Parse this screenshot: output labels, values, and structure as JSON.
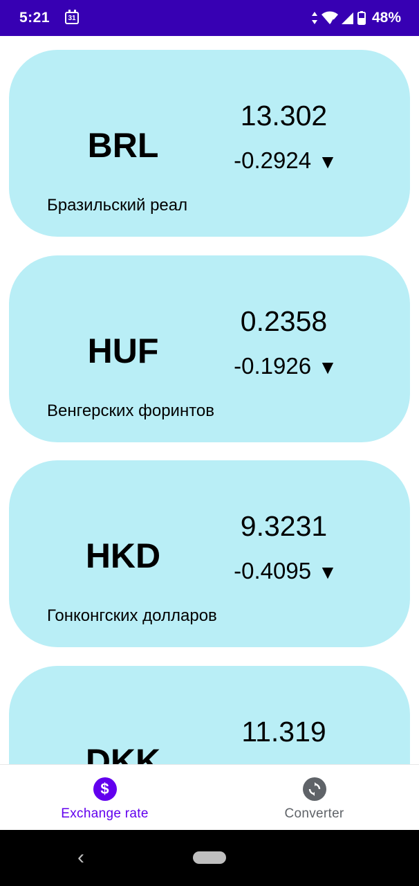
{
  "status_bar": {
    "time": "5:21",
    "calendar_day": "31",
    "battery": "48%"
  },
  "cards": [
    {
      "code": "BRL",
      "rate": "13.302",
      "change": "-0.2924",
      "arrow": "▼",
      "name": "Бразильский реал"
    },
    {
      "code": "HUF",
      "rate": "0.2358",
      "change": "-0.1926",
      "arrow": "▼",
      "name": "Венгерских форинтов"
    },
    {
      "code": "HKD",
      "rate": "9.3231",
      "change": "-0.4095",
      "arrow": "▼",
      "name": "Гонконгских долларов"
    },
    {
      "code": "DKK",
      "rate": "11.319",
      "change": "",
      "arrow": "",
      "name": ""
    }
  ],
  "bottom_nav": {
    "items": [
      {
        "label": "Exchange rate",
        "icon": "dollar-icon",
        "active": true
      },
      {
        "label": "Converter",
        "icon": "sync-icon",
        "active": false
      }
    ],
    "active_color": "#6200ee",
    "inactive_color": "#5f6368"
  },
  "colors": {
    "status_bar": "#3700b3",
    "card_background": "#b9eef6"
  }
}
